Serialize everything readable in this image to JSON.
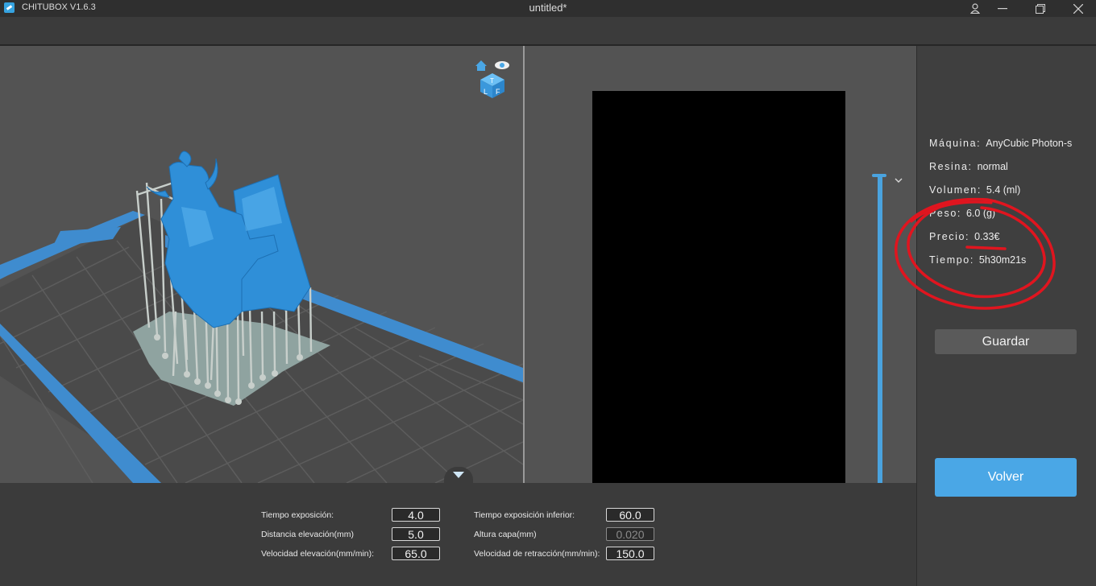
{
  "app": {
    "name": "CHITUBOX V1.6.3",
    "document_title": "untitled*"
  },
  "window_controls": [
    "user-icon",
    "minimize-icon",
    "restore-icon",
    "close-icon"
  ],
  "view_cube": {
    "face_top": "T",
    "face_left": "L",
    "face_front": "F"
  },
  "info": {
    "machine_label": "Máquina:",
    "machine_value": "AnyCubic Photon-s",
    "resin_label": "Resina:",
    "resin_value": "normal",
    "volume_label": "Volumen:",
    "volume_value": "5.4  (ml)",
    "weight_label": "Peso:",
    "weight_value": "6.0  (g)",
    "price_label": "Precio:",
    "price_value": "0.33€",
    "time_label": "Tiempo:",
    "time_value": "5h30m21s"
  },
  "buttons": {
    "save": "Guardar",
    "back": "Volver"
  },
  "settings": {
    "exposure_time": {
      "label": "Tiempo exposición:",
      "value": "4.0"
    },
    "lift_distance": {
      "label": "Distancia elevación(mm)",
      "value": "5.0"
    },
    "lift_speed": {
      "label": "Velocidad elevación(mm/min):",
      "value": "65.0"
    },
    "bottom_exposure_time": {
      "label": "Tiempo exposición inferior:",
      "value": "60.0"
    },
    "layer_height": {
      "label": "Altura capa(mm)",
      "value": "0.020"
    },
    "retract_speed": {
      "label": "Velocidad de retracción(mm/min):",
      "value": "150.0"
    }
  },
  "colors": {
    "accent": "#4aa7e6",
    "model": "#2f8fd8",
    "supports": "#c9cfcc",
    "annotation": "#e0151f",
    "background": "#535353"
  }
}
